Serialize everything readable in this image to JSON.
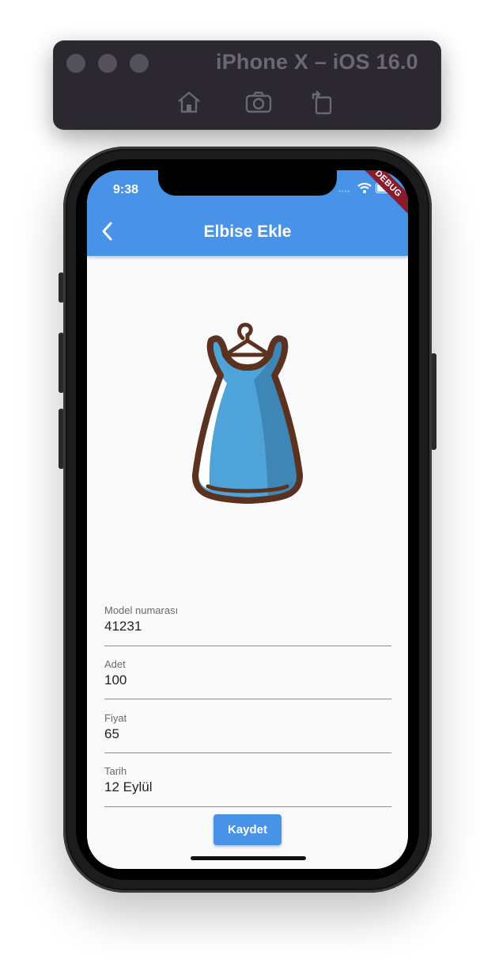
{
  "simulator": {
    "title": "iPhone X – iOS 16.0",
    "buttons": [
      "home-icon",
      "screenshot-icon",
      "rotate-icon"
    ]
  },
  "status_bar": {
    "time": "9:38",
    "debug_banner": "DEBUG"
  },
  "app_bar": {
    "title": "Elbise Ekle",
    "back_icon": "chevron-left-icon",
    "color": "#4893e8"
  },
  "illustration": {
    "icon": "dress-icon",
    "colors": {
      "outline": "#5b3220",
      "dress": "#4ea3d8",
      "shade": "#3e86b5"
    }
  },
  "form": {
    "fields": [
      {
        "label": "Model numarası",
        "value": "41231"
      },
      {
        "label": "Adet",
        "value": "100"
      },
      {
        "label": "Fiyat",
        "value": "65"
      },
      {
        "label": "Tarih",
        "value": "12 Eylül"
      }
    ],
    "save_label": "Kaydet"
  }
}
